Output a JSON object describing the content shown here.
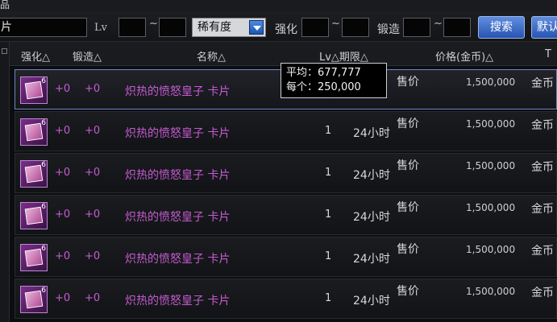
{
  "window": {
    "corner_glyph": "品"
  },
  "search": {
    "name_value": "片",
    "lv_label": "Lv",
    "tilde": "~",
    "rarity_selected": "稀有度",
    "enhance_label": "强化",
    "forge_label": "锻造",
    "search_button": "搜索",
    "default_button": "默认"
  },
  "columns": {
    "enhance": "强化△",
    "forge": "锻造△",
    "name": "名称△",
    "lv_period": "Lv△期限△",
    "price": "价格(金币)△",
    "extra": "T"
  },
  "tooltip": {
    "line1": "平均：677,777",
    "line2": "每个：250,000"
  },
  "rows": [
    {
      "badge": "6",
      "enhance": "+0",
      "forge": "+0",
      "name": "炽热的愤怒皇子 卡片",
      "lv": "",
      "period": "",
      "type": "售价",
      "price": "1,500,000",
      "currency": "金币"
    },
    {
      "badge": "6",
      "enhance": "+0",
      "forge": "+0",
      "name": "炽热的愤怒皇子 卡片",
      "lv": "1",
      "period": "24小时",
      "type": "售价",
      "price": "1,500,000",
      "currency": "金币"
    },
    {
      "badge": "6",
      "enhance": "+0",
      "forge": "+0",
      "name": "炽热的愤怒皇子 卡片",
      "lv": "1",
      "period": "24小时",
      "type": "售价",
      "price": "1,500,000",
      "currency": "金币"
    },
    {
      "badge": "6",
      "enhance": "+0",
      "forge": "+0",
      "name": "炽热的愤怒皇子 卡片",
      "lv": "1",
      "period": "24小时",
      "type": "售价",
      "price": "1,500,000",
      "currency": "金币"
    },
    {
      "badge": "6",
      "enhance": "+0",
      "forge": "+0",
      "name": "炽热的愤怒皇子 卡片",
      "lv": "1",
      "period": "24小时",
      "type": "售价",
      "price": "1,500,000",
      "currency": "金币"
    },
    {
      "badge": "6",
      "enhance": "+0",
      "forge": "+0",
      "name": "炽热的愤怒皇子 卡片",
      "lv": "1",
      "period": "24小时",
      "type": "售价",
      "price": "1,500,000",
      "currency": "金币"
    }
  ]
}
